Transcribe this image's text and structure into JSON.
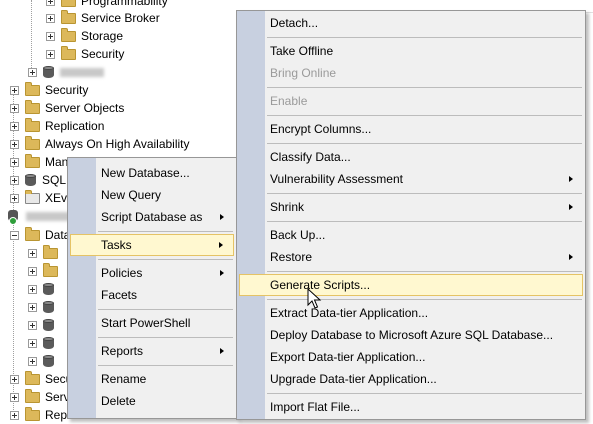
{
  "tree": {
    "rows": [
      {
        "label": "Programmability",
        "indent": 2
      },
      {
        "label": "Service Broker",
        "indent": 2
      },
      {
        "label": "Storage",
        "indent": 2
      },
      {
        "label": "Security",
        "indent": 2
      },
      {
        "label": "",
        "indent": 1
      },
      {
        "label": "Security",
        "indent": 0
      },
      {
        "label": "Server Objects",
        "indent": 0
      },
      {
        "label": "Replication",
        "indent": 0
      },
      {
        "label": "Always On High Availability",
        "indent": 0
      },
      {
        "label": "Man",
        "indent": 0
      },
      {
        "label": "SQL",
        "indent": 0
      },
      {
        "label": "XEv",
        "indent": 0
      },
      {
        "label": "",
        "indent": 0
      },
      {
        "label": "Data",
        "indent": 0
      },
      {
        "label": "Secu",
        "indent": 0
      },
      {
        "label": "Serv",
        "indent": 0
      },
      {
        "label": "Rep",
        "indent": 0
      }
    ]
  },
  "menu1": {
    "items": [
      "New Database...",
      "New Query",
      "Script Database as",
      "Tasks",
      "Policies",
      "Facets",
      "Start PowerShell",
      "Reports",
      "Rename",
      "Delete"
    ]
  },
  "menu2": {
    "items": [
      "Detach...",
      "Take Offline",
      "Bring Online",
      "Enable",
      "Encrypt Columns...",
      "Classify Data...",
      "Vulnerability Assessment",
      "Shrink",
      "Back Up...",
      "Restore",
      "Generate Scripts...",
      "Extract Data-tier Application...",
      "Deploy Database to Microsoft Azure SQL Database...",
      "Export Data-tier Application...",
      "Upgrade Data-tier Application...",
      "Import Flat File..."
    ]
  }
}
